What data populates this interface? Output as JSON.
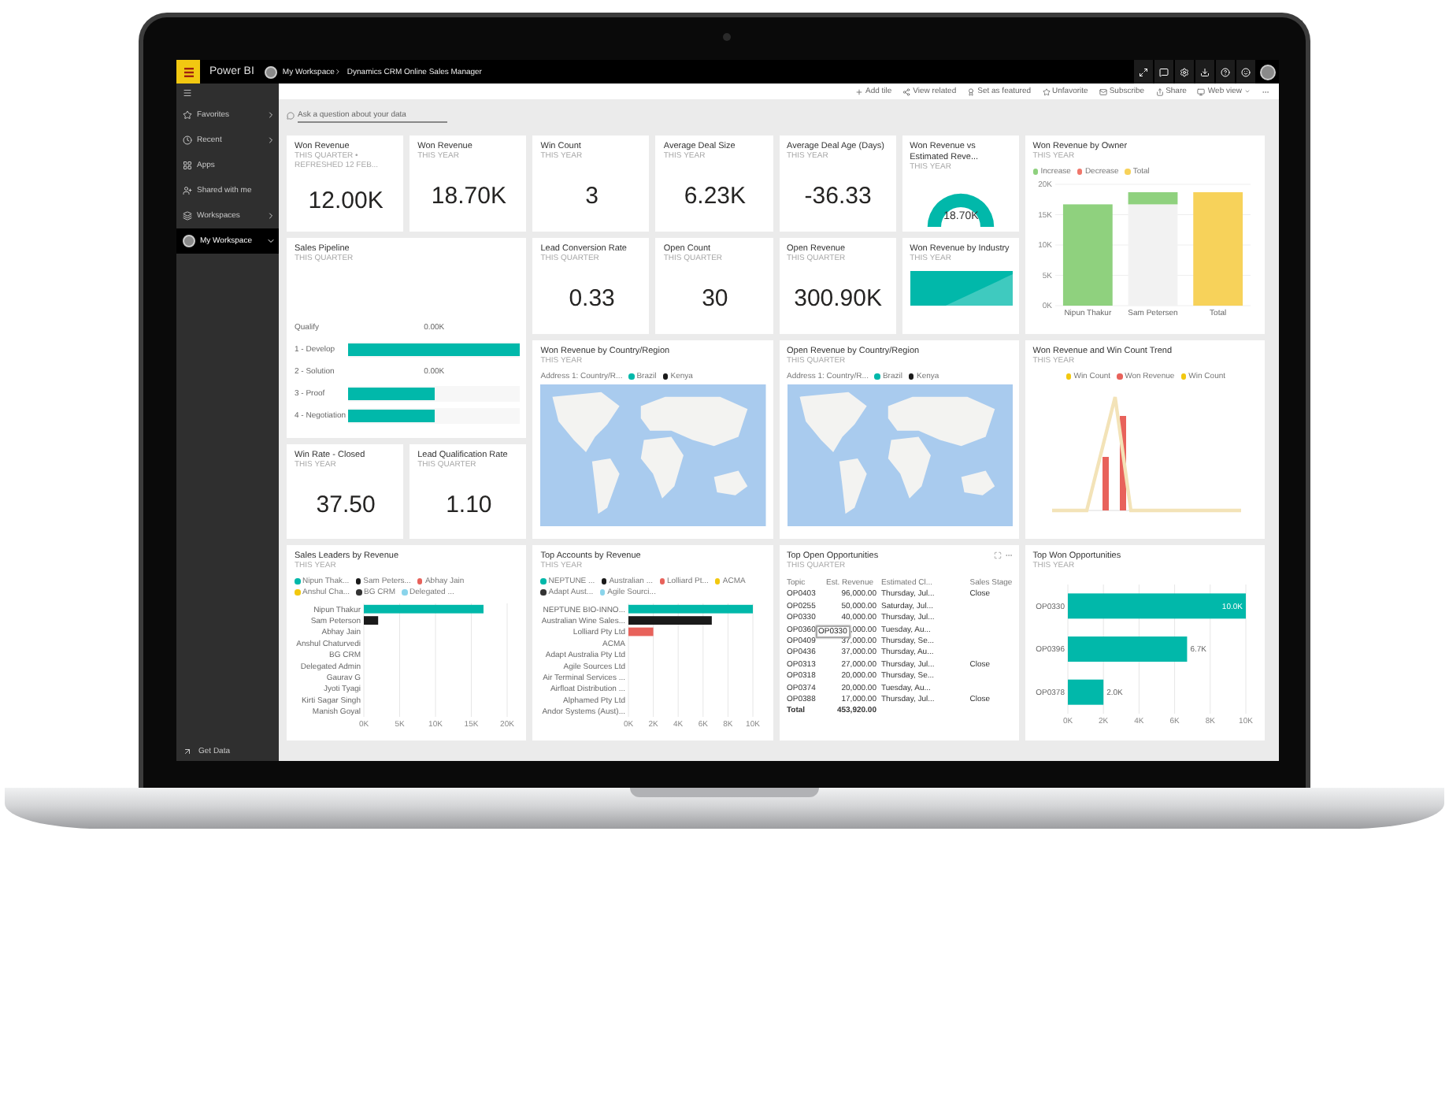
{
  "header": {
    "app_name": "Power BI",
    "breadcrumb": [
      "My Workspace",
      "Dynamics CRM Online Sales Manager"
    ]
  },
  "sidebar": {
    "items": [
      {
        "label": "Favorites",
        "kind": "expandable",
        "selected": false
      },
      {
        "label": "Recent",
        "kind": "expandable",
        "selected": false
      },
      {
        "label": "Apps",
        "kind": "plain",
        "selected": false
      },
      {
        "label": "Shared with me",
        "kind": "plain",
        "selected": false
      },
      {
        "label": "Workspaces",
        "kind": "expandable",
        "selected": false
      },
      {
        "label": "My Workspace",
        "kind": "workspace",
        "selected": true
      }
    ],
    "footer": "Get Data"
  },
  "toolbar": [
    "Add tile",
    "View related",
    "Set as featured",
    "Unfavorite",
    "Subscribe",
    "Share",
    "Web view"
  ],
  "qna": {
    "placeholder": "Ask a question about your data"
  },
  "tiles": [
    {
      "kind": "card",
      "title": "Won Revenue",
      "subtitle": "THIS QUARTER • REFRESHED 12 FEB...",
      "value": "12.00K"
    },
    {
      "kind": "card",
      "title": "Won Revenue",
      "subtitle": "THIS YEAR",
      "value": "18.70K"
    },
    {
      "kind": "card",
      "title": "Win Count",
      "subtitle": "THIS YEAR",
      "value": "3"
    },
    {
      "kind": "card",
      "title": "Average Deal Size",
      "subtitle": "THIS YEAR",
      "value": "6.23K"
    },
    {
      "kind": "card",
      "title": "Average Deal Age (Days)",
      "subtitle": "THIS YEAR",
      "value": "-36.33"
    },
    {
      "kind": "gauge",
      "title": "Won Revenue vs Estimated Reve...",
      "subtitle": "THIS YEAR",
      "value": "18.70K"
    },
    {
      "kind": "waterfall",
      "title": "Won Revenue by Owner",
      "subtitle": "THIS YEAR",
      "chart_data": {
        "type": "bar",
        "orientation": "vertical",
        "categories": [
          "Nipun Thakur",
          "Sam Petersen",
          "Total"
        ],
        "stacked": true,
        "grid": true,
        "series": [
          {
            "color": "#f2f2f2",
            "values": [
              null,
              16.7,
              null
            ]
          },
          {
            "name": "Increase",
            "color": "#8fd17e",
            "values": [
              16.7,
              2,
              null
            ]
          },
          {
            "name": "Decrease",
            "color": "#f0776b",
            "values": [
              null,
              null,
              null
            ]
          },
          {
            "name": "Total",
            "color": "#f7d25a",
            "values": [
              null,
              null,
              18.7
            ]
          }
        ],
        "ylim": [
          0,
          20
        ],
        "yticks": [
          {
            "value": 0,
            "label": "0K"
          },
          {
            "value": 5,
            "label": "5K"
          },
          {
            "value": 10,
            "label": "10K"
          },
          {
            "value": 15,
            "label": "15K"
          },
          {
            "value": 20,
            "label": "20K"
          }
        ]
      }
    },
    {
      "kind": "funnel",
      "title": "Sales Pipeline",
      "subtitle": "THIS QUARTER",
      "stages": [
        {
          "label": "Qualify",
          "value": "0.00K"
        },
        {
          "label": "1 - Develop",
          "level": 1
        },
        {
          "label": "2 - Solution",
          "value": "0.00K"
        },
        {
          "label": "3 - Proof",
          "level": 0.5
        },
        {
          "label": "4 - Negotiation",
          "level": 0.5
        }
      ]
    },
    {
      "kind": "card",
      "title": "Lead Conversion Rate",
      "subtitle": "THIS QUARTER",
      "value": "0.33"
    },
    {
      "kind": "card",
      "title": "Open Count",
      "subtitle": "THIS QUARTER",
      "value": "30"
    },
    {
      "kind": "card",
      "title": "Open Revenue",
      "subtitle": "THIS QUARTER",
      "value": "300.90K"
    },
    {
      "kind": "treemap",
      "title": "Won Revenue by Industry",
      "subtitle": "THIS YEAR"
    },
    {
      "kind": "map",
      "title": "Won Revenue by Country/Region",
      "subtitle": "THIS YEAR",
      "legend_title": "Address 1: Country/R...",
      "legend": [
        {
          "label": "Brazil",
          "color": "#01b8aa"
        },
        {
          "label": "Kenya",
          "color": "#1a1a1a"
        }
      ]
    },
    {
      "kind": "map",
      "title": "Open Revenue by Country/Region",
      "subtitle": "THIS QUARTER",
      "legend_title": "Address 1: Country/R...",
      "legend": [
        {
          "label": "Brazil",
          "color": "#01b8aa"
        },
        {
          "label": "Kenya",
          "color": "#1a1a1a"
        }
      ]
    },
    {
      "kind": "combo",
      "title": "Won Revenue and Win Count Trend",
      "subtitle": "THIS YEAR",
      "legend": [
        {
          "label": "Win Count",
          "color": "#f2c80f"
        },
        {
          "label": "Won Revenue",
          "color": "#e8625b"
        },
        {
          "label": "Win Count",
          "color": "#f2c80f"
        }
      ]
    },
    {
      "kind": "card",
      "title": "Win Rate - Closed",
      "subtitle": "THIS YEAR",
      "value": "37.50"
    },
    {
      "kind": "card",
      "title": "Lead Qualification Rate",
      "subtitle": "THIS QUARTER",
      "value": "1.10"
    },
    {
      "kind": "hbar",
      "title": "Sales Leaders by Revenue",
      "subtitle": "THIS YEAR",
      "chart_data": {
        "type": "bar",
        "orientation": "horizontal",
        "stacked": true,
        "grid": true,
        "categories": [
          "Nipun Thakur",
          "Sam Peterson",
          "Abhay Jain",
          "Anshul Chaturvedi",
          "BG CRM",
          "Delegated Admin",
          "Gaurav G",
          "Jyoti Tyagi",
          "Kirti Sagar Singh",
          "Manish Goyal"
        ],
        "series": [
          {
            "name": "Nipun Thak...",
            "color": "#01b8aa",
            "values": [
              16.7,
              null,
              null,
              null,
              null,
              null,
              null,
              null,
              null,
              null
            ]
          },
          {
            "name": "Sam Peters...",
            "color": "#1a1a1a",
            "values": [
              null,
              2,
              null,
              null,
              null,
              null,
              null,
              null,
              null,
              null
            ]
          },
          {
            "name": "Abhay Jain",
            "color": "#e8625b",
            "values": [
              null,
              null,
              0,
              null,
              null,
              null,
              null,
              null,
              null,
              null
            ]
          },
          {
            "name": "Anshul Cha...",
            "color": "#f2c80f",
            "values": [
              null,
              null,
              null,
              0,
              null,
              null,
              null,
              null,
              null,
              null
            ]
          },
          {
            "name": "BG CRM",
            "color": "#333333",
            "values": [
              null,
              null,
              null,
              null,
              0,
              null,
              null,
              null,
              null,
              null
            ]
          },
          {
            "name": "Delegated ...",
            "color": "#8ad4eb",
            "values": [
              null,
              null,
              null,
              null,
              null,
              0,
              null,
              null,
              null,
              null
            ]
          }
        ],
        "xlim": [
          0,
          20
        ],
        "xticks": [
          {
            "value": 0,
            "label": "0K"
          },
          {
            "value": 5,
            "label": "5K"
          },
          {
            "value": 10,
            "label": "10K"
          },
          {
            "value": 15,
            "label": "15K"
          },
          {
            "value": 20,
            "label": "20K"
          }
        ]
      }
    },
    {
      "kind": "hbar",
      "title": "Top Accounts by Revenue",
      "subtitle": "THIS YEAR",
      "chart_data": {
        "type": "bar",
        "orientation": "horizontal",
        "stacked": true,
        "grid": true,
        "categories": [
          "NEPTUNE BIO-INNO...",
          "Australian Wine Sales...",
          "Lolliard Pty Ltd",
          "ACMA",
          "Adapt Australia Pty Ltd",
          "Agile Sources Ltd",
          "Air Terminal Services ...",
          "Airfloat Distribution ...",
          "Alphamed Pty Ltd",
          "Andor Systems (Aust)..."
        ],
        "series": [
          {
            "name": "NEPTUNE ...",
            "color": "#01b8aa",
            "values": [
              10,
              null,
              null,
              null,
              null,
              null,
              null,
              null,
              null,
              null
            ]
          },
          {
            "name": "Australian ...",
            "color": "#1a1a1a",
            "values": [
              null,
              6.7,
              null,
              null,
              null,
              null,
              null,
              null,
              null,
              null
            ]
          },
          {
            "name": "Lolliard Pt...",
            "color": "#e8625b",
            "values": [
              null,
              null,
              2,
              null,
              null,
              null,
              null,
              null,
              null,
              null
            ]
          },
          {
            "name": "ACMA",
            "color": "#f2c80f",
            "values": [
              null,
              null,
              null,
              0,
              null,
              null,
              null,
              null,
              null,
              null
            ]
          },
          {
            "name": "Adapt Aust...",
            "color": "#333333",
            "values": [
              null,
              null,
              null,
              null,
              0,
              null,
              null,
              null,
              null,
              null
            ]
          },
          {
            "name": "Agile Sourci...",
            "color": "#8ad4eb",
            "values": [
              null,
              null,
              null,
              null,
              null,
              0,
              null,
              null,
              null,
              null
            ]
          }
        ],
        "xlim": [
          0,
          10
        ],
        "xticks": [
          {
            "value": 0,
            "label": "0K"
          },
          {
            "value": 2,
            "label": "2K"
          },
          {
            "value": 4,
            "label": "4K"
          },
          {
            "value": 6,
            "label": "6K"
          },
          {
            "value": 8,
            "label": "8K"
          },
          {
            "value": 10,
            "label": "10K"
          }
        ]
      }
    },
    {
      "kind": "table",
      "title": "Top Open Opportunities",
      "subtitle": "THIS QUARTER",
      "columns": [
        "Topic",
        "Est. Revenue",
        "Estimated Cl...",
        "Sales Stage"
      ],
      "rows": [
        [
          "OP0403",
          "96,000.00",
          "Thursday, Jul...",
          "Close"
        ],
        [
          "OP0255",
          "50,000.00",
          "Saturday, Jul...",
          ""
        ],
        [
          "OP0330",
          "40,000.00",
          "Thursday, Jul...",
          ""
        ],
        [
          "OP0360",
          ",000.00",
          "Tuesday, Au...",
          ""
        ],
        [
          "OP0409",
          "37,000.00",
          "Thursday, Se...",
          ""
        ],
        [
          "OP0436",
          "37,000.00",
          "Thursday, Au...",
          ""
        ],
        [
          "OP0313",
          "27,000.00",
          "Thursday, Jul...",
          "Close"
        ],
        [
          "OP0318",
          "20,000.00",
          "Thursday, Se...",
          ""
        ],
        [
          "OP0374",
          "20,000.00",
          "Tuesday, Au...",
          ""
        ],
        [
          "OP0388",
          "17,000.00",
          "Thursday, Jul...",
          "Close"
        ]
      ],
      "total": [
        "Total",
        "453,920.00"
      ],
      "tooltip": "OP0330"
    },
    {
      "kind": "hbar",
      "title": "Top Won Opportunities",
      "subtitle": "THIS YEAR",
      "chart_data": {
        "type": "bar",
        "orientation": "horizontal",
        "stacked": false,
        "grid": true,
        "categories": [
          "OP0330",
          "OP0396",
          "OP0378"
        ],
        "series": [
          {
            "color": "#01b8aa",
            "values": [
              10,
              6.7,
              2
            ]
          }
        ],
        "value_labels": [
          "10.0K",
          "6.7K",
          "2.0K"
        ],
        "xlim": [
          0,
          10
        ],
        "xticks": [
          {
            "value": 0,
            "label": "0K"
          },
          {
            "value": 2,
            "label": "2K"
          },
          {
            "value": 4,
            "label": "4K"
          },
          {
            "value": 6,
            "label": "6K"
          },
          {
            "value": 8,
            "label": "8K"
          },
          {
            "value": 10,
            "label": "10K"
          }
        ]
      }
    }
  ]
}
